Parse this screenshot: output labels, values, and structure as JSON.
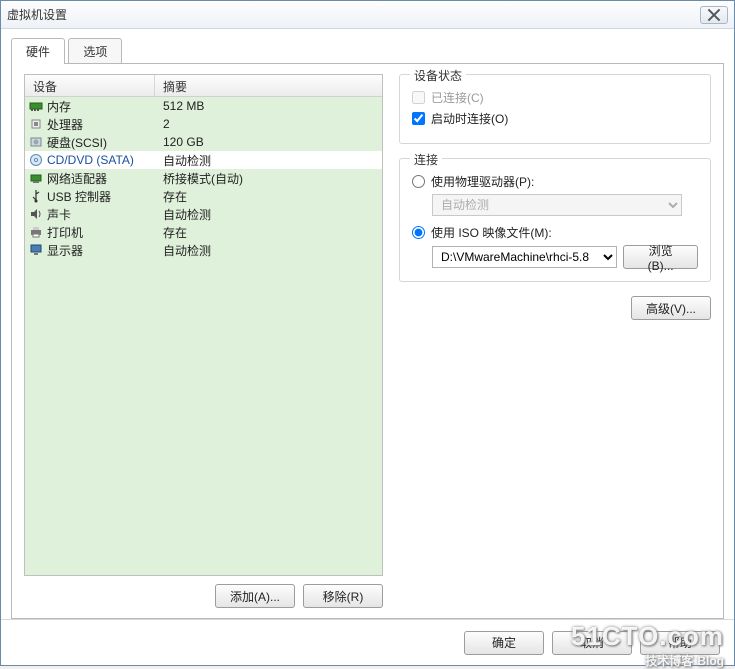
{
  "window": {
    "title": "虚拟机设置"
  },
  "tabs": [
    {
      "label": "硬件",
      "active": true
    },
    {
      "label": "选项",
      "active": false
    }
  ],
  "hw_headers": {
    "device": "设备",
    "summary": "摘要"
  },
  "hw": [
    {
      "icon": "memory-icon",
      "label": "内存",
      "summary": "512 MB",
      "selected": false
    },
    {
      "icon": "cpu-icon",
      "label": "处理器",
      "summary": "2",
      "selected": false
    },
    {
      "icon": "hdd-icon",
      "label": "硬盘(SCSI)",
      "summary": "120 GB",
      "selected": false
    },
    {
      "icon": "disc-icon",
      "label": "CD/DVD (SATA)",
      "summary": "自动检测",
      "selected": true
    },
    {
      "icon": "nic-icon",
      "label": "网络适配器",
      "summary": "桥接模式(自动)",
      "selected": false
    },
    {
      "icon": "usb-icon",
      "label": "USB 控制器",
      "summary": "存在",
      "selected": false
    },
    {
      "icon": "sound-icon",
      "label": "声卡",
      "summary": "自动检测",
      "selected": false
    },
    {
      "icon": "printer-icon",
      "label": "打印机",
      "summary": "存在",
      "selected": false
    },
    {
      "icon": "display-icon",
      "label": "显示器",
      "summary": "自动检测",
      "selected": false
    }
  ],
  "left_buttons": {
    "add": "添加(A)...",
    "remove": "移除(R)"
  },
  "status_group": {
    "title": "设备状态",
    "connected": {
      "label": "已连接(C)",
      "checked": false,
      "enabled": false
    },
    "connect_at_poweron": {
      "label": "启动时连接(O)",
      "checked": true,
      "enabled": true
    }
  },
  "connection_group": {
    "title": "连接",
    "use_physical": {
      "label": "使用物理驱动器(P):",
      "selected": false,
      "drive_value": "自动检测"
    },
    "use_iso": {
      "label": "使用 ISO 映像文件(M):",
      "selected": true,
      "path": "D:\\VMwareMachine\\rhci-5.8",
      "browse": "浏览(B)..."
    }
  },
  "advanced_btn": "高级(V)...",
  "footer": {
    "ok": "确定",
    "cancel": "取消",
    "help": "帮助"
  },
  "watermark": {
    "line1": "51CTO.com",
    "line2": "技术博客",
    "suffix": "Blog"
  }
}
